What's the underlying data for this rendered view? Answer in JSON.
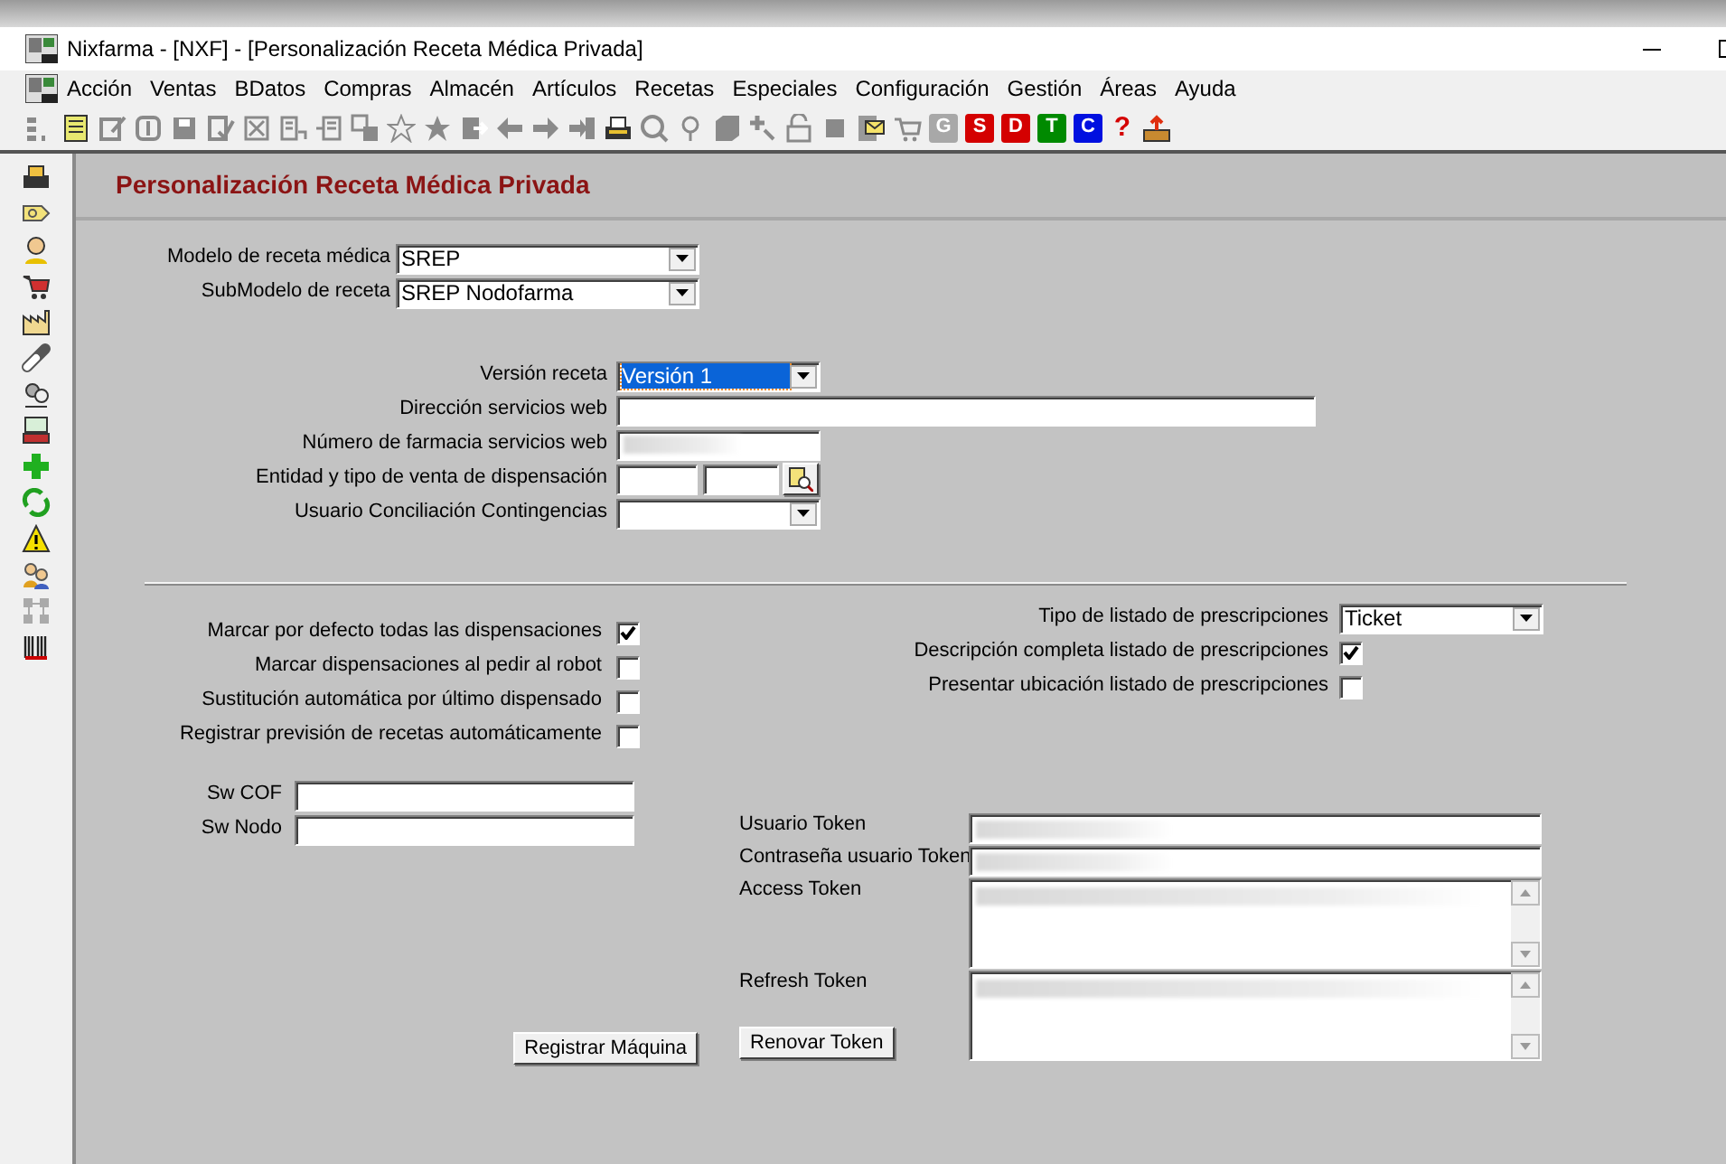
{
  "window": {
    "title": "Nixfarma - [NXF] - [Personalización Receta Médica Privada]"
  },
  "menu": [
    "Acción",
    "Ventas",
    "BDatos",
    "Compras",
    "Almacén",
    "Artículos",
    "Recetas",
    "Especiales",
    "Configuración",
    "Gestión",
    "Áreas",
    "Ayuda"
  ],
  "toolbar_letters": [
    {
      "kind": "tile",
      "label": "G",
      "color": "#a8a8a8"
    },
    {
      "kind": "tile",
      "label": "S",
      "color": "#d40000"
    },
    {
      "kind": "tile",
      "label": "D",
      "color": "#d40000"
    },
    {
      "kind": "tile",
      "label": "T",
      "color": "#008a00"
    },
    {
      "kind": "tile",
      "label": "C",
      "color": "#0010e0"
    },
    {
      "kind": "glyph",
      "label": "?",
      "color": "#d40000"
    }
  ],
  "page_title": "Personalización Receta Médica Privada",
  "receta": [
    {
      "label": "Modelo de receta médica",
      "value": "SREP"
    },
    {
      "label": "SubModelo de receta",
      "value": "SREP Nodofarma"
    }
  ],
  "servicios": [
    {
      "kind": "combo",
      "label": "Versión receta",
      "value": "Versión 1",
      "focused": true
    },
    {
      "kind": "text",
      "label": "Dirección servicios web"
    },
    {
      "kind": "text",
      "label": "Número de farmacia servicios web",
      "redacted": true
    },
    {
      "kind": "lookup",
      "label": "Entidad y tipo de venta de dispensación"
    },
    {
      "kind": "combo",
      "label": "Usuario Conciliación Contingencias"
    }
  ],
  "options_left": [
    {
      "label": "Marcar por defecto todas las dispensaciones",
      "checked": true
    },
    {
      "label": "Marcar dispensaciones al pedir al robot",
      "checked": false
    },
    {
      "label": "Sustitución automática por último dispensado",
      "checked": false
    },
    {
      "label": "Registrar previsión de recetas automáticamente",
      "checked": false
    }
  ],
  "options_right": [
    {
      "kind": "combo",
      "label": "Tipo de listado de prescripciones",
      "value": "Ticket"
    },
    {
      "kind": "check",
      "label": "Descripción completa listado de prescripciones",
      "checked": true
    },
    {
      "kind": "check",
      "label": "Presentar ubicación listado de prescripciones",
      "checked": false
    }
  ],
  "switches": [
    {
      "label": "Sw COF"
    },
    {
      "label": "Sw Nodo"
    }
  ],
  "tokens": [
    {
      "kind": "text",
      "label": "Usuario Token",
      "redacted": true
    },
    {
      "kind": "text",
      "label": "Contraseña usuario Token",
      "redacted": true
    },
    {
      "kind": "memo",
      "label": "Access Token",
      "redacted": true
    },
    {
      "kind": "memo",
      "label": "Refresh Token",
      "redacted": true
    }
  ],
  "buttons": [
    "Registrar Máquina",
    "Renovar Token"
  ]
}
